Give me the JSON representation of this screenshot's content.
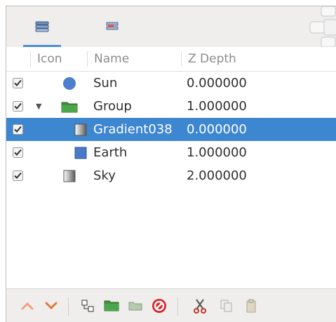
{
  "columns": {
    "icon": "Icon",
    "name": "Name",
    "zdepth": "Z Depth"
  },
  "rows": [
    {
      "name": "Sun",
      "zdepth": "0.000000",
      "checked": true,
      "icon": "circle-layer-icon",
      "selected": false
    },
    {
      "name": "Group",
      "zdepth": "1.000000",
      "checked": true,
      "icon": "folder-icon",
      "expanded": true,
      "selected": false
    },
    {
      "name": "Gradient038",
      "zdepth": "0.000000",
      "checked": true,
      "icon": "gradient-layer-icon",
      "selected": true
    },
    {
      "name": "Earth",
      "zdepth": "1.000000",
      "checked": true,
      "icon": "rectangle-layer-icon",
      "selected": false
    },
    {
      "name": "Sky",
      "zdepth": "2.000000",
      "checked": true,
      "icon": "gradient-layer-icon",
      "selected": false
    }
  ],
  "tabs": [
    {
      "icon": "layers-panel-icon",
      "active": true
    },
    {
      "icon": "params-panel-icon",
      "active": false
    }
  ],
  "toolbar": [
    "raise-layer-icon",
    "lower-layer-icon",
    "duplicate-layer-icon",
    "group-layer-icon",
    "encapsulate-layer-icon",
    "delete-layer-icon",
    "cut-icon",
    "copy-icon",
    "paste-icon"
  ],
  "colors": {
    "selection": "#3d86d0",
    "folder": "#3f8f3f",
    "circle": "#4d7fd1",
    "delete": "#d9262b",
    "arrows": "#e07b39"
  }
}
